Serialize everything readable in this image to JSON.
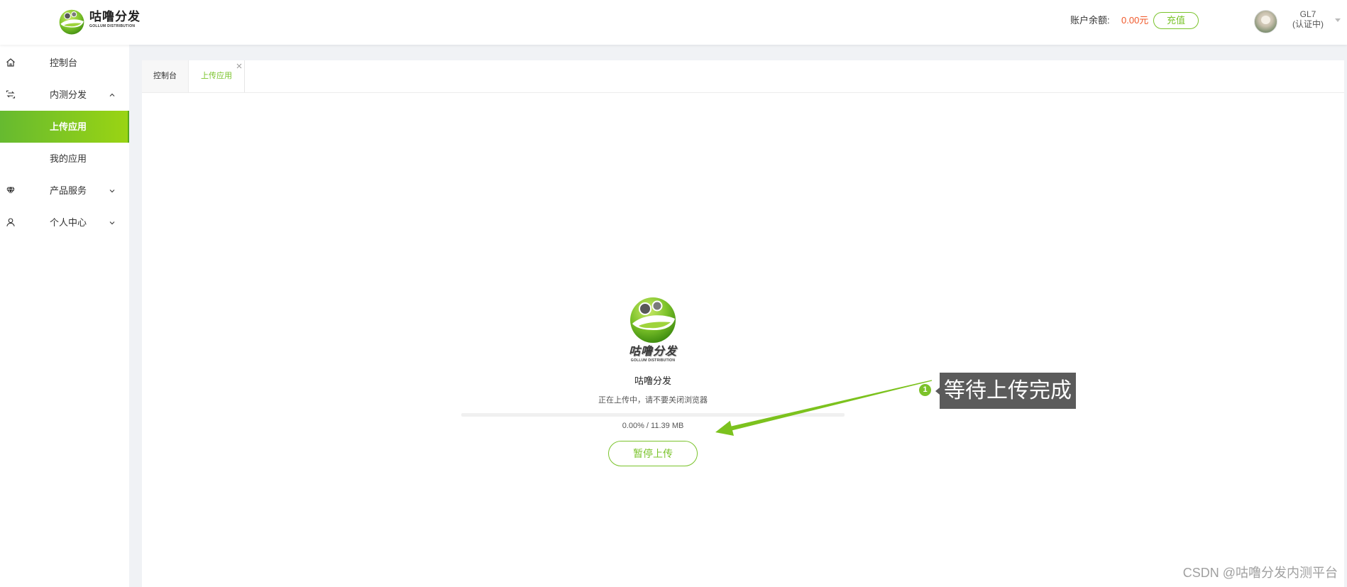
{
  "header": {
    "logo": {
      "name": "咕噜分发",
      "subtitle": "GOLLUM DISTRIBUTION",
      "icon": "gollum-logo"
    },
    "balance_label": "账户余额:",
    "balance_value": "0.00元",
    "recharge_label": "充值",
    "user": {
      "name": "GL7",
      "status": "(认证中)",
      "avatar": "avatar-image",
      "menu_icon": "caret-down-icon"
    }
  },
  "sidebar": {
    "items": [
      {
        "label": "控制台",
        "icon": "home-icon"
      },
      {
        "label": "内测分发",
        "icon": "transfer-icon",
        "expanded": true,
        "chevron": "chevron-up-icon",
        "children": [
          {
            "label": "上传应用",
            "active": true
          },
          {
            "label": "我的应用"
          }
        ]
      },
      {
        "label": "产品服务",
        "icon": "gem-icon",
        "expanded": false,
        "chevron": "chevron-down-icon"
      },
      {
        "label": "个人中心",
        "icon": "user-icon",
        "expanded": false,
        "chevron": "chevron-down-icon"
      }
    ]
  },
  "tabs": [
    {
      "label": "控制台"
    },
    {
      "label": "上传应用",
      "active": true,
      "close_icon": "close-icon"
    }
  ],
  "upload": {
    "logo": {
      "wordmark": "咕噜分发",
      "tagline": "GOLLUM DISTRIBUTION"
    },
    "app_name": "咕噜分发",
    "status": "正在上传中，请不要关闭浏览器",
    "progress": 0,
    "progress_text": "0.00% / 11.39 MB",
    "pause_label": "暂停上传"
  },
  "annotation": {
    "number": "1",
    "text": "等待上传完成"
  },
  "watermark": "CSDN @咕噜分发内测平台",
  "colors": {
    "brand": "#7ac32b",
    "balance": "#f0582a",
    "page_bg": "#f0f2f5",
    "annotation_bg": "#5b5b5b"
  }
}
